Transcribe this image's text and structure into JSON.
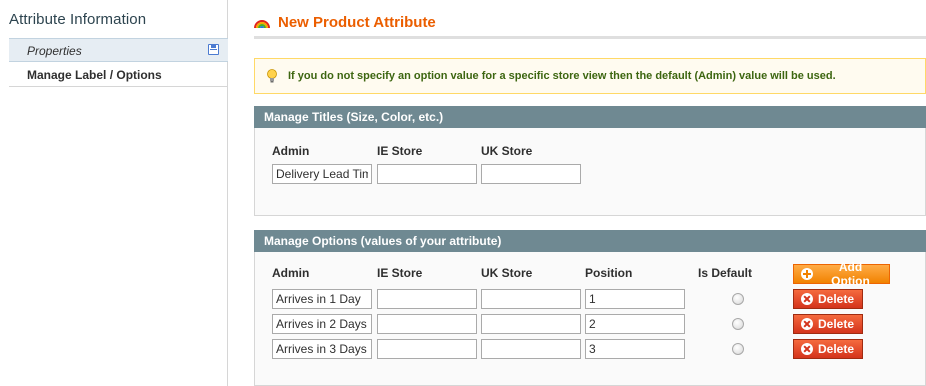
{
  "sidebar": {
    "title": "Attribute Information",
    "tabs": [
      {
        "label": "Properties"
      },
      {
        "label": "Manage Label / Options"
      }
    ]
  },
  "header": {
    "title": "New Product Attribute"
  },
  "notice": {
    "text": "If you do not specify an option value for a specific store view then the default (Admin) value will be used."
  },
  "titles_section": {
    "heading": "Manage Titles (Size, Color, etc.)",
    "columns": [
      "Admin",
      "IE Store",
      "UK Store"
    ],
    "values": {
      "admin": "Delivery Lead Time",
      "ie_store": "",
      "uk_store": ""
    }
  },
  "options_section": {
    "heading": "Manage Options (values of your attribute)",
    "columns": [
      "Admin",
      "IE Store",
      "UK Store",
      "Position",
      "Is Default"
    ],
    "add_label": "Add Option",
    "delete_label": "Delete",
    "rows": [
      {
        "admin": "Arrives in 1 Day",
        "ie_store": "",
        "uk_store": "",
        "position": "1",
        "is_default": false
      },
      {
        "admin": "Arrives in 2 Days",
        "ie_store": "",
        "uk_store": "",
        "position": "2",
        "is_default": false
      },
      {
        "admin": "Arrives in 3 Days",
        "ie_store": "",
        "uk_store": "",
        "position": "3",
        "is_default": false
      }
    ]
  },
  "colors": {
    "accent": "#eb5e00",
    "section_header": "#6f8992",
    "notice_text": "#3d6611",
    "delete_button": "#d4331b",
    "add_button": "#f18200"
  }
}
